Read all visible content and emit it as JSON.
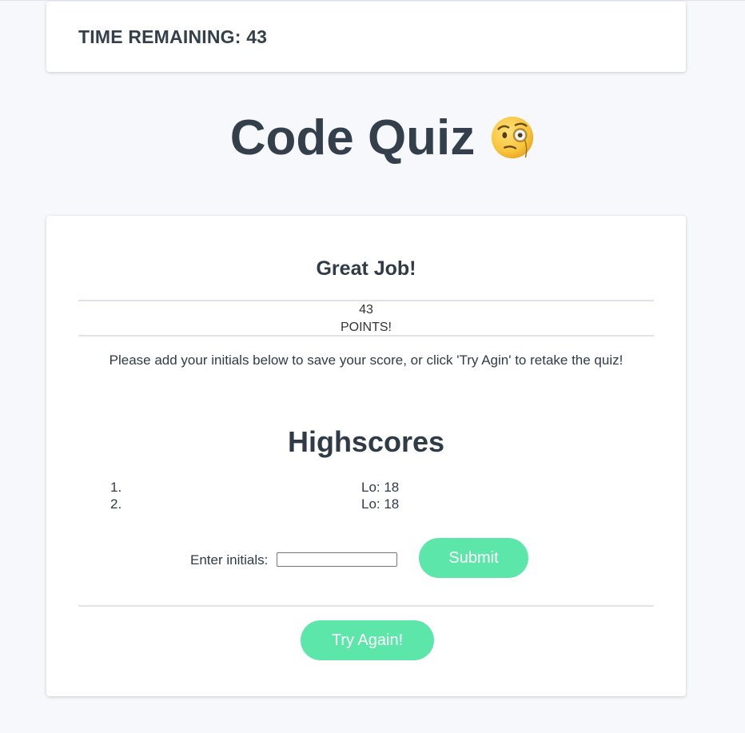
{
  "timer": {
    "label": "TIME REMAINING: 43"
  },
  "header": {
    "title": "Code Quiz"
  },
  "result": {
    "heading": "Great Job!",
    "score": "43",
    "score_unit": "POINTS!",
    "instructions": "Please add your initials below to save your score, or click 'Try Agin' to retake the quiz!"
  },
  "highscores": {
    "title": "Highscores",
    "entries": [
      {
        "rank": "1.",
        "text": "Lo: 18"
      },
      {
        "rank": "2.",
        "text": "Lo: 18"
      }
    ]
  },
  "form": {
    "label": "Enter initials:",
    "value": "",
    "submit_label": "Submit"
  },
  "actions": {
    "try_again_label": "Try Again!"
  },
  "colors": {
    "accent": "#5ce6aa",
    "text": "#2f3b47",
    "background": "#f7f8fc"
  },
  "icons": {
    "title_emoji": "face-with-monocle-icon"
  }
}
